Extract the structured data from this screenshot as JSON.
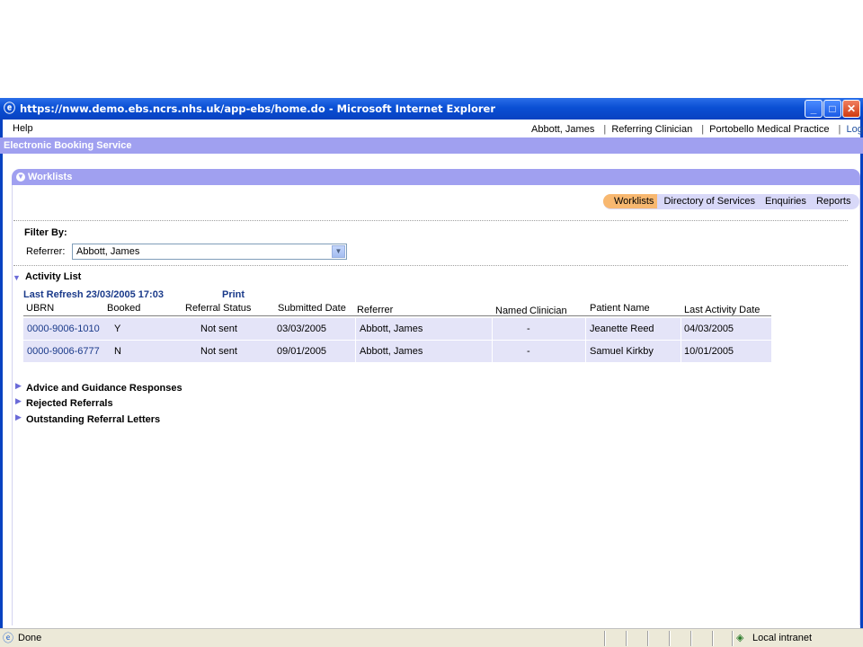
{
  "window": {
    "title": "https://nww.demo.ebs.ncrs.nhs.uk/app-ebs/home.do - Microsoft Internet Explorer",
    "ie_icon": "ie-logo-icon",
    "minimize": "_",
    "maximize": "□",
    "close": "✕"
  },
  "menu": {
    "help": "Help",
    "user_name": "Abbott, James",
    "role": "Referring Clinician",
    "practice": "Portobello Medical Practice",
    "logout": "Log Out",
    "separator": "|"
  },
  "app": {
    "title": "Electronic Booking Service"
  },
  "worklists": {
    "heading": "Worklists"
  },
  "nav": {
    "items": [
      "Worklists",
      "Directory of Services",
      "Enquiries",
      "Reports"
    ],
    "active": "Worklists"
  },
  "filter": {
    "title": "Filter By:",
    "referrer_label": "Referrer:",
    "referrer_value": "Abbott, James"
  },
  "activity": {
    "title": "Activity List",
    "last_refresh": "Last Refresh 23/03/2005 17:03",
    "print": "Print",
    "columns": {
      "ubrn": "UBRN",
      "booked": "Booked",
      "referral_status": "Referral Status",
      "submitted_date": "Submitted Date",
      "referrer": "Referrer",
      "named": "Named",
      "clinician": "Clinician",
      "patient_name": "Patient Name",
      "last_activity_date": "Last Activity Date"
    },
    "rows": [
      {
        "ubrn": "0000-9006-1010",
        "booked": "Y",
        "status": "Not sent",
        "submitted": "03/03/2005",
        "referrer": "Abbott, James",
        "clinician": "-",
        "patient": "Jeanette Reed",
        "last_activity": "04/03/2005"
      },
      {
        "ubrn": "0000-9006-6777",
        "booked": "N",
        "status": "Not sent",
        "submitted": "09/01/2005",
        "referrer": "Abbott, James",
        "clinician": "-",
        "patient": "Samuel Kirkby",
        "last_activity": "10/01/2005"
      }
    ]
  },
  "sections": [
    "Advice and Guidance Responses",
    "Rejected Referrals",
    "Outstanding Referral Letters"
  ],
  "status": {
    "text": "Done",
    "zone": "Local intranet"
  },
  "colors": {
    "accent": "#a0a0f0",
    "title_bar": "#0a4fd4",
    "active_tab": "#f8b870",
    "row_bg": "#e4e4f8",
    "link": "#1a3a8a"
  }
}
